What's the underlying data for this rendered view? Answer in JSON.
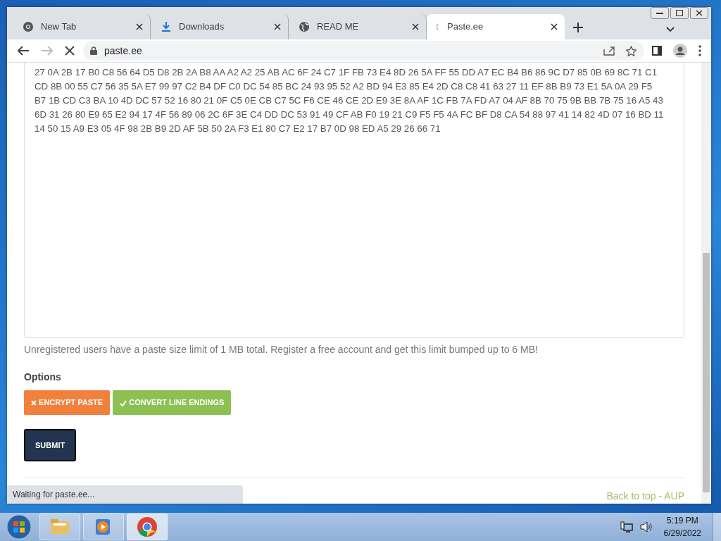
{
  "tabs": [
    {
      "label": "New Tab",
      "kind": "chrome",
      "selected": false
    },
    {
      "label": "Downloads",
      "kind": "download",
      "selected": false
    },
    {
      "label": "READ ME",
      "kind": "globe",
      "selected": false
    },
    {
      "label": "Paste.ee",
      "kind": "loading",
      "selected": true
    }
  ],
  "address_bar": {
    "url": "paste.ee"
  },
  "paste": {
    "lines": [
      "27 0A 2B 17 B0 C8 56 64 D5 D8 2B 2A B8 AA A2 A2 25 AB AC 6F 24 C7 1F FB 73 E4 8D 26 5A FF 55 DD A7 EC B4 B6 86 9C D7 85 0B 69 8C 71 C1",
      "CD 8B 00 55 C7 56 35 5A E7 99 97 C2 B4 DF C0 DC 54 85 BC 24 93 95 52 A2 BD 94 E3 85 E4 2D C8 C8 41 63 27 11 EF 8B B9 73 E1 5A 0A 29 F5",
      "B7 1B CD C3 BA 10 4D DC 57 52 16 80 21 0F C5 0E CB C7 5C F6 CE 46 CE 2D E9 3E 8A AF 1C FB 7A FD A7 04 AF 8B 70 75 9B BB 7B 75 16 A5 43",
      "6D 31 26 80 E9 65 E2 94 17 4F 56 89 06 2C 6F 3E C4 DD DC 53 91 49 CF AB F0 19 21 C9 F5 F5 4A FC BF D8 CA 54 88 97 41 14 82 4D 07 16 BD 11",
      "14 50 15 A9 E3 05 4F 98 2B B9 2D AF 5B 50 2A F3 E1 80 C7 E2 17 B7 0D 98 ED A5 29 26 66 71"
    ]
  },
  "notice": "Unregistered users have a paste size limit of 1 MB total. Register a free account and get this limit bumped up to 6 MB!",
  "options": {
    "heading": "Options",
    "items": [
      {
        "label": "ENCRYPT PASTE",
        "on": false
      },
      {
        "label": "CONVERT LINE ENDINGS",
        "on": true
      }
    ]
  },
  "submit": "SUBMIT",
  "footer": {
    "back_to_top": "Back to top",
    "separator": "-",
    "aup": "AUP"
  },
  "status": "Waiting for paste.ee...",
  "taskbar": {
    "apps": [
      {
        "kind": "folder",
        "selected": false
      },
      {
        "kind": "media",
        "selected": false
      },
      {
        "kind": "chrome",
        "selected": true
      }
    ],
    "time": "5:19 PM",
    "date": "6/29/2022"
  }
}
